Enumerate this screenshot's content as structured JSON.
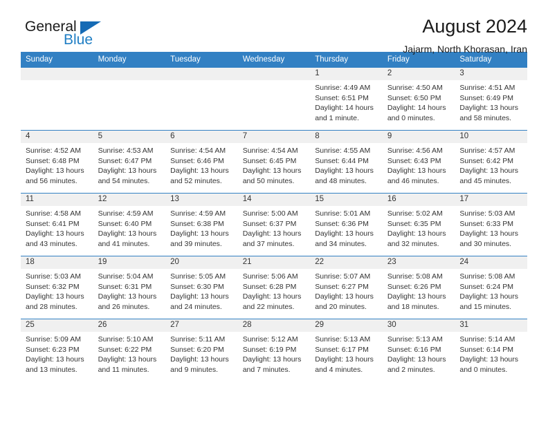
{
  "brand": {
    "word_one": "General",
    "word_two": "Blue",
    "accent_color": "#1f7ec4"
  },
  "header": {
    "title": "August 2024",
    "subtitle": "Jajarm, North Khorasan, Iran"
  },
  "calendar": {
    "header_color": "#3280c3",
    "weekday_headers": [
      "Sunday",
      "Monday",
      "Tuesday",
      "Wednesday",
      "Thursday",
      "Friday",
      "Saturday"
    ],
    "weeks": [
      [
        {
          "day": "",
          "lines": []
        },
        {
          "day": "",
          "lines": []
        },
        {
          "day": "",
          "lines": []
        },
        {
          "day": "",
          "lines": []
        },
        {
          "day": "1",
          "lines": [
            "Sunrise: 4:49 AM",
            "Sunset: 6:51 PM",
            "Daylight: 14 hours",
            "and 1 minute."
          ]
        },
        {
          "day": "2",
          "lines": [
            "Sunrise: 4:50 AM",
            "Sunset: 6:50 PM",
            "Daylight: 14 hours",
            "and 0 minutes."
          ]
        },
        {
          "day": "3",
          "lines": [
            "Sunrise: 4:51 AM",
            "Sunset: 6:49 PM",
            "Daylight: 13 hours",
            "and 58 minutes."
          ]
        }
      ],
      [
        {
          "day": "4",
          "lines": [
            "Sunrise: 4:52 AM",
            "Sunset: 6:48 PM",
            "Daylight: 13 hours",
            "and 56 minutes."
          ]
        },
        {
          "day": "5",
          "lines": [
            "Sunrise: 4:53 AM",
            "Sunset: 6:47 PM",
            "Daylight: 13 hours",
            "and 54 minutes."
          ]
        },
        {
          "day": "6",
          "lines": [
            "Sunrise: 4:54 AM",
            "Sunset: 6:46 PM",
            "Daylight: 13 hours",
            "and 52 minutes."
          ]
        },
        {
          "day": "7",
          "lines": [
            "Sunrise: 4:54 AM",
            "Sunset: 6:45 PM",
            "Daylight: 13 hours",
            "and 50 minutes."
          ]
        },
        {
          "day": "8",
          "lines": [
            "Sunrise: 4:55 AM",
            "Sunset: 6:44 PM",
            "Daylight: 13 hours",
            "and 48 minutes."
          ]
        },
        {
          "day": "9",
          "lines": [
            "Sunrise: 4:56 AM",
            "Sunset: 6:43 PM",
            "Daylight: 13 hours",
            "and 46 minutes."
          ]
        },
        {
          "day": "10",
          "lines": [
            "Sunrise: 4:57 AM",
            "Sunset: 6:42 PM",
            "Daylight: 13 hours",
            "and 45 minutes."
          ]
        }
      ],
      [
        {
          "day": "11",
          "lines": [
            "Sunrise: 4:58 AM",
            "Sunset: 6:41 PM",
            "Daylight: 13 hours",
            "and 43 minutes."
          ]
        },
        {
          "day": "12",
          "lines": [
            "Sunrise: 4:59 AM",
            "Sunset: 6:40 PM",
            "Daylight: 13 hours",
            "and 41 minutes."
          ]
        },
        {
          "day": "13",
          "lines": [
            "Sunrise: 4:59 AM",
            "Sunset: 6:38 PM",
            "Daylight: 13 hours",
            "and 39 minutes."
          ]
        },
        {
          "day": "14",
          "lines": [
            "Sunrise: 5:00 AM",
            "Sunset: 6:37 PM",
            "Daylight: 13 hours",
            "and 37 minutes."
          ]
        },
        {
          "day": "15",
          "lines": [
            "Sunrise: 5:01 AM",
            "Sunset: 6:36 PM",
            "Daylight: 13 hours",
            "and 34 minutes."
          ]
        },
        {
          "day": "16",
          "lines": [
            "Sunrise: 5:02 AM",
            "Sunset: 6:35 PM",
            "Daylight: 13 hours",
            "and 32 minutes."
          ]
        },
        {
          "day": "17",
          "lines": [
            "Sunrise: 5:03 AM",
            "Sunset: 6:33 PM",
            "Daylight: 13 hours",
            "and 30 minutes."
          ]
        }
      ],
      [
        {
          "day": "18",
          "lines": [
            "Sunrise: 5:03 AM",
            "Sunset: 6:32 PM",
            "Daylight: 13 hours",
            "and 28 minutes."
          ]
        },
        {
          "day": "19",
          "lines": [
            "Sunrise: 5:04 AM",
            "Sunset: 6:31 PM",
            "Daylight: 13 hours",
            "and 26 minutes."
          ]
        },
        {
          "day": "20",
          "lines": [
            "Sunrise: 5:05 AM",
            "Sunset: 6:30 PM",
            "Daylight: 13 hours",
            "and 24 minutes."
          ]
        },
        {
          "day": "21",
          "lines": [
            "Sunrise: 5:06 AM",
            "Sunset: 6:28 PM",
            "Daylight: 13 hours",
            "and 22 minutes."
          ]
        },
        {
          "day": "22",
          "lines": [
            "Sunrise: 5:07 AM",
            "Sunset: 6:27 PM",
            "Daylight: 13 hours",
            "and 20 minutes."
          ]
        },
        {
          "day": "23",
          "lines": [
            "Sunrise: 5:08 AM",
            "Sunset: 6:26 PM",
            "Daylight: 13 hours",
            "and 18 minutes."
          ]
        },
        {
          "day": "24",
          "lines": [
            "Sunrise: 5:08 AM",
            "Sunset: 6:24 PM",
            "Daylight: 13 hours",
            "and 15 minutes."
          ]
        }
      ],
      [
        {
          "day": "25",
          "lines": [
            "Sunrise: 5:09 AM",
            "Sunset: 6:23 PM",
            "Daylight: 13 hours",
            "and 13 minutes."
          ]
        },
        {
          "day": "26",
          "lines": [
            "Sunrise: 5:10 AM",
            "Sunset: 6:22 PM",
            "Daylight: 13 hours",
            "and 11 minutes."
          ]
        },
        {
          "day": "27",
          "lines": [
            "Sunrise: 5:11 AM",
            "Sunset: 6:20 PM",
            "Daylight: 13 hours",
            "and 9 minutes."
          ]
        },
        {
          "day": "28",
          "lines": [
            "Sunrise: 5:12 AM",
            "Sunset: 6:19 PM",
            "Daylight: 13 hours",
            "and 7 minutes."
          ]
        },
        {
          "day": "29",
          "lines": [
            "Sunrise: 5:13 AM",
            "Sunset: 6:17 PM",
            "Daylight: 13 hours",
            "and 4 minutes."
          ]
        },
        {
          "day": "30",
          "lines": [
            "Sunrise: 5:13 AM",
            "Sunset: 6:16 PM",
            "Daylight: 13 hours",
            "and 2 minutes."
          ]
        },
        {
          "day": "31",
          "lines": [
            "Sunrise: 5:14 AM",
            "Sunset: 6:14 PM",
            "Daylight: 13 hours",
            "and 0 minutes."
          ]
        }
      ]
    ]
  }
}
